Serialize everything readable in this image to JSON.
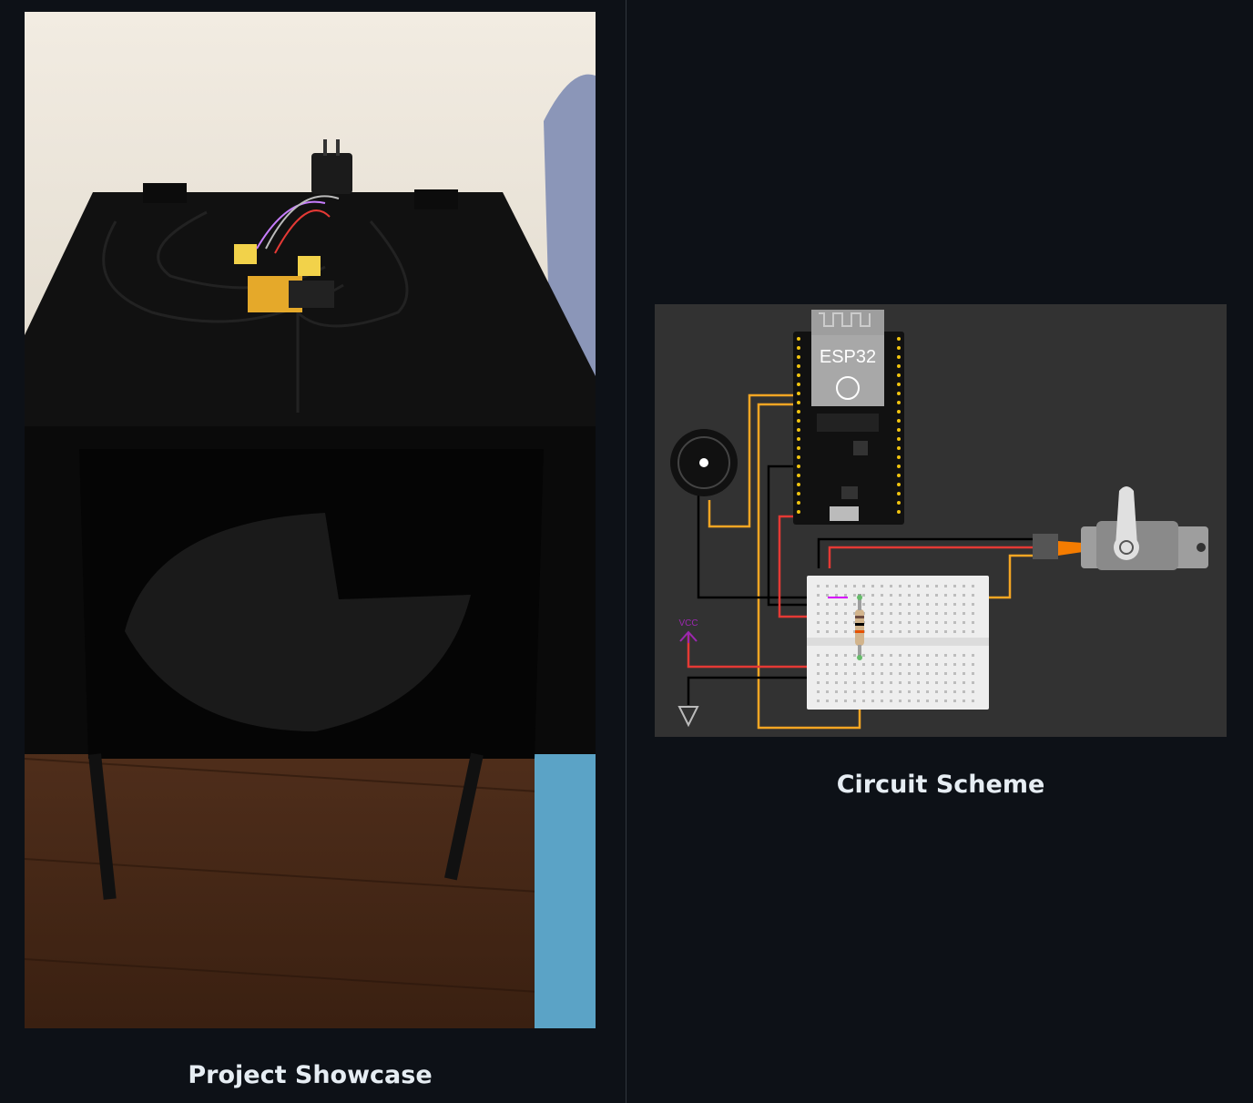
{
  "captions": {
    "left": "Project Showcase",
    "right": "Circuit Scheme"
  },
  "scheme": {
    "board_label": "ESP32",
    "vcc_label": "VCC"
  },
  "colors": {
    "background": "#0d1117",
    "divider": "#30363d",
    "caption": "#e6edf3",
    "scheme_background": "#323232",
    "wire_red": "#e53935",
    "wire_orange": "#f5a623",
    "wire_black": "#000000",
    "vcc_purple": "#9c27b0"
  }
}
